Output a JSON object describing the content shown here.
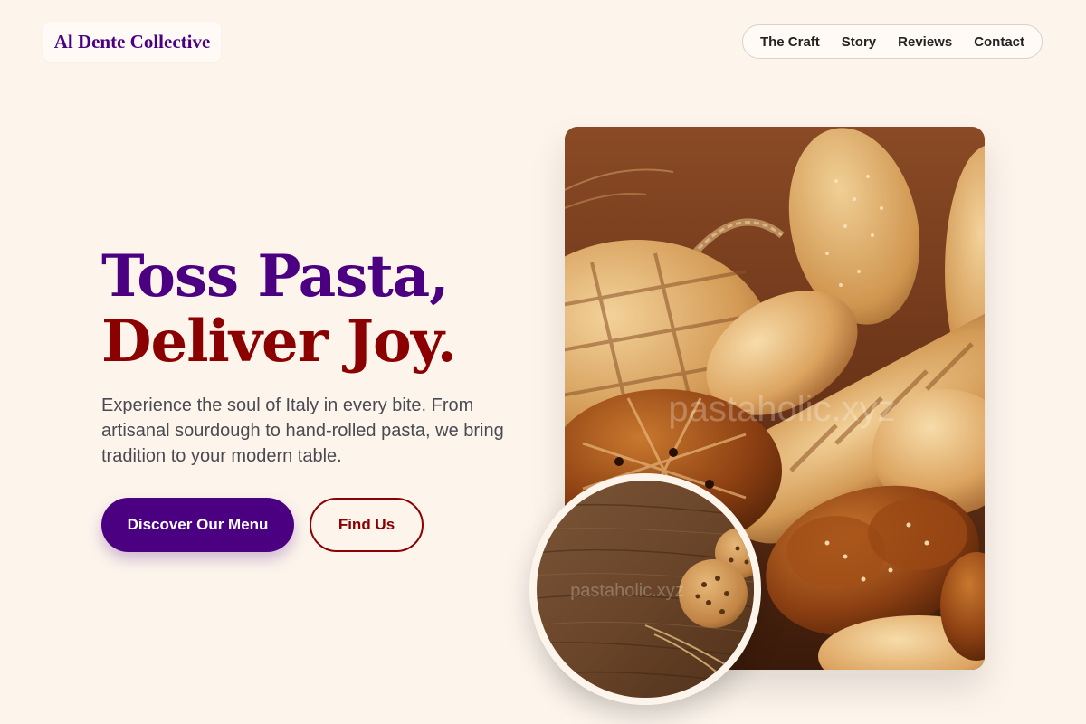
{
  "brand": {
    "name": "Al Dente Collective"
  },
  "nav": {
    "items": [
      "The Craft",
      "Story",
      "Reviews",
      "Contact"
    ]
  },
  "hero": {
    "headline_line1": "Toss Pasta,",
    "headline_line2": "Deliver Joy.",
    "lede": "Experience the soul of Italy in every bite. From artisanal sourdough to hand-rolled pasta, we bring tradition to your modern table.",
    "primary_cta": "Discover Our Menu",
    "secondary_cta": "Find Us"
  },
  "images": {
    "main_watermark": "pastaholic.xyz",
    "inset_watermark": "pastaholic.xyz"
  },
  "colors": {
    "background": "#fdf5ec",
    "brand_purple": "#4b0082",
    "deep_red": "#8b0000"
  }
}
